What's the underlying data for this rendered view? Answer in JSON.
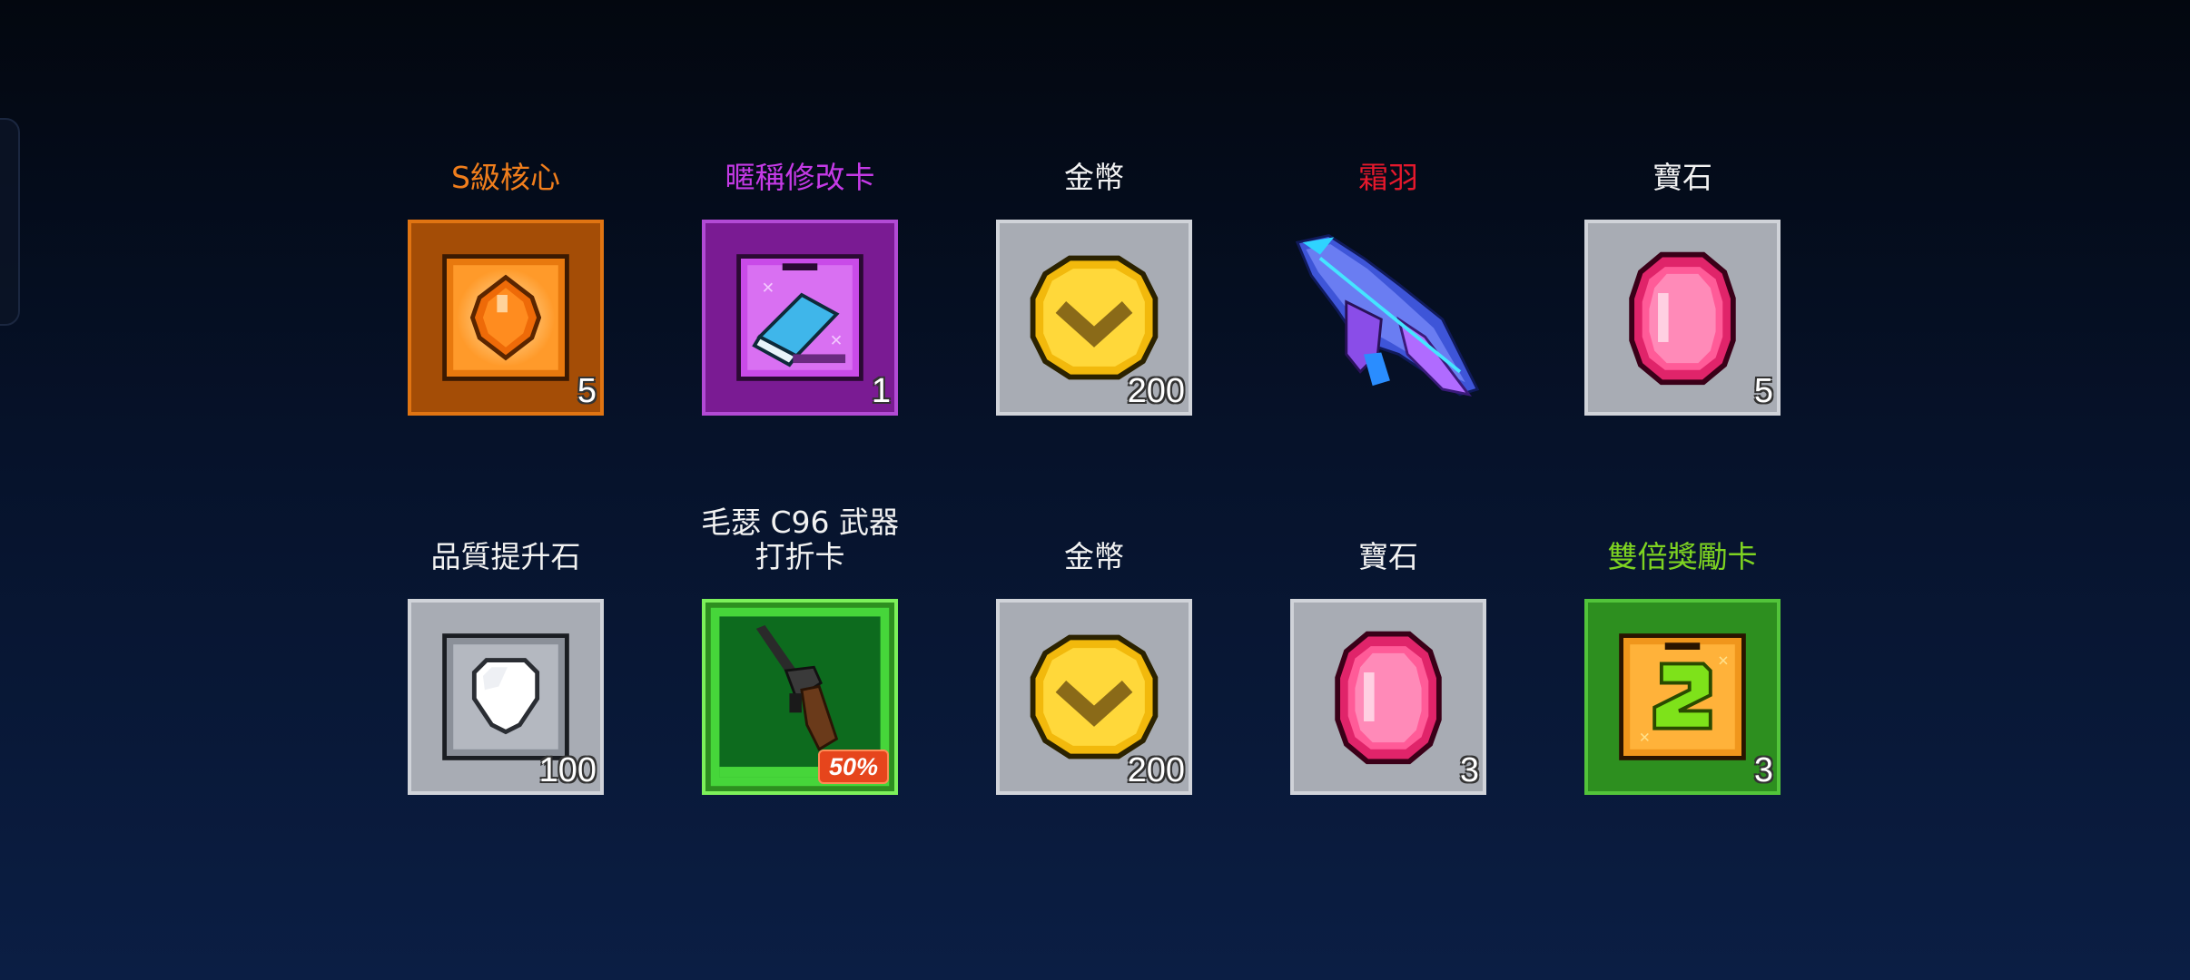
{
  "rewards": [
    {
      "name": "S級核心",
      "name_color": "#f07e1c",
      "qty": "5",
      "tile": "orange",
      "icon": "orange-core-icon"
    },
    {
      "name": "暱稱修改卡",
      "name_color": "#c53ae6",
      "qty": "1",
      "tile": "purple",
      "icon": "eraser-card-icon"
    },
    {
      "name": "金幣",
      "name_color": "#f2f2f2",
      "qty": "200",
      "tile": "gray",
      "icon": "gold-coin-icon"
    },
    {
      "name": "霜羽",
      "name_color": "#e5182c",
      "qty": "",
      "tile": "none",
      "icon": "frost-wing-gun-icon"
    },
    {
      "name": "寶石",
      "name_color": "#f2f2f2",
      "qty": "5",
      "tile": "gray",
      "icon": "pink-gem-icon"
    },
    {
      "name": "品質提升石",
      "name_color": "#f2f2f2",
      "qty": "100",
      "tile": "gray",
      "icon": "white-stone-icon"
    },
    {
      "name_line1": "毛瑟 C96 武器",
      "name_line2": "打折卡",
      "name_color": "#f2f2f2",
      "badge": "50%",
      "tile": "green",
      "icon": "mauser-pistol-icon"
    },
    {
      "name": "金幣",
      "name_color": "#f2f2f2",
      "qty": "200",
      "tile": "gray",
      "icon": "gold-coin-icon"
    },
    {
      "name": "寶石",
      "name_color": "#f2f2f2",
      "qty": "3",
      "tile": "gray",
      "icon": "pink-gem-icon"
    },
    {
      "name": "雙倍獎勵卡",
      "name_color": "#7ed321",
      "qty": "3",
      "tile": "green",
      "icon": "double-reward-card-icon"
    }
  ]
}
